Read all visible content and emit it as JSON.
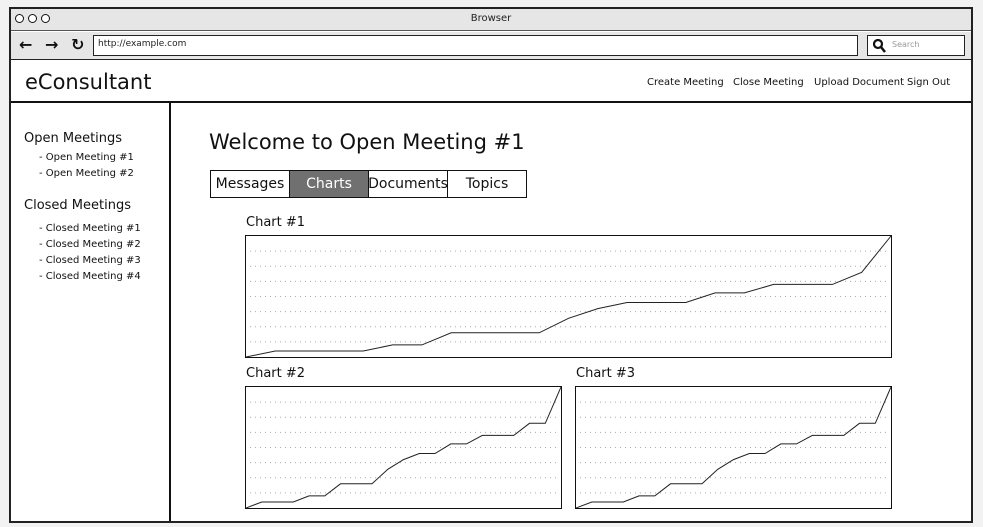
{
  "browser": {
    "title": "Browser",
    "url": "http://example.com",
    "search_placeholder": "Search"
  },
  "app": {
    "brand": "eConsultant",
    "menu": [
      "Create Meeting",
      "Close Meeting",
      "Upload Document",
      "Sign Out"
    ]
  },
  "sidebar": {
    "open_title": "Open Meetings",
    "open_items": [
      "- Open Meeting #1",
      "- Open Meeting #2"
    ],
    "closed_title": "Closed Meetings",
    "closed_items": [
      "- Closed Meeting #1",
      "- Closed Meeting #2",
      "- Closed Meeting #3",
      "- Closed Meeting #4"
    ]
  },
  "main": {
    "title": "Welcome to Open Meeting #1",
    "tabs": [
      "Messages",
      "Charts",
      "Documents",
      "Topics"
    ],
    "active_tab": "Charts"
  },
  "chart_data": [
    {
      "type": "line",
      "title": "Chart #1",
      "xlim": [
        0,
        22
      ],
      "ylim": [
        0,
        10
      ],
      "grid": "horizontal dotted",
      "x": [
        0,
        1,
        2,
        3,
        4,
        5,
        6,
        7,
        8,
        9,
        10,
        11,
        12,
        13,
        14,
        15,
        16,
        17,
        18,
        19,
        20,
        21,
        22
      ],
      "y": [
        0,
        0.5,
        0.5,
        0.5,
        0.5,
        1.0,
        1.0,
        2.0,
        2.0,
        2.0,
        2.0,
        3.2,
        4.0,
        4.5,
        4.5,
        4.5,
        5.3,
        5.3,
        6.0,
        6.0,
        6.0,
        7.0,
        10.0
      ]
    },
    {
      "type": "line",
      "title": "Chart #2",
      "xlim": [
        0,
        20
      ],
      "ylim": [
        0,
        10
      ],
      "grid": "horizontal dotted",
      "x": [
        0,
        1,
        2,
        3,
        4,
        5,
        6,
        7,
        8,
        9,
        10,
        11,
        12,
        13,
        14,
        15,
        16,
        17,
        18,
        19,
        20
      ],
      "y": [
        0,
        0.5,
        0.5,
        0.5,
        1.0,
        1.0,
        2.0,
        2.0,
        2.0,
        3.2,
        4.0,
        4.5,
        4.5,
        5.3,
        5.3,
        6.0,
        6.0,
        6.0,
        7.0,
        7.0,
        10.0
      ]
    },
    {
      "type": "line",
      "title": "Chart #3",
      "xlim": [
        0,
        20
      ],
      "ylim": [
        0,
        10
      ],
      "grid": "horizontal dotted",
      "x": [
        0,
        1,
        2,
        3,
        4,
        5,
        6,
        7,
        8,
        9,
        10,
        11,
        12,
        13,
        14,
        15,
        16,
        17,
        18,
        19,
        20
      ],
      "y": [
        0,
        0.5,
        0.5,
        0.5,
        1.0,
        1.0,
        2.0,
        2.0,
        2.0,
        3.2,
        4.0,
        4.5,
        4.5,
        5.3,
        5.3,
        6.0,
        6.0,
        6.0,
        7.0,
        7.0,
        10.0
      ]
    }
  ]
}
